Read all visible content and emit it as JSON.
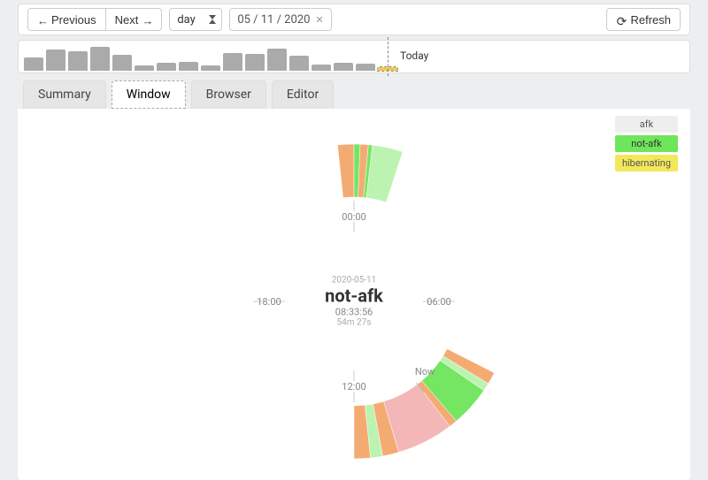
{
  "controls": {
    "previous": "Previous",
    "next": "Next",
    "period_selected": "day",
    "date": "05 / 11 / 2020",
    "refresh": "Refresh"
  },
  "sparkline": {
    "heights_pct": [
      48,
      74,
      70,
      84,
      56,
      20,
      28,
      32,
      20,
      62,
      58,
      78,
      54,
      22,
      28,
      26,
      12
    ],
    "today_index": 16,
    "today_label": "Today"
  },
  "tabs": [
    {
      "key": "summary",
      "label": "Summary"
    },
    {
      "key": "window",
      "label": "Window"
    },
    {
      "key": "browser",
      "label": "Browser"
    },
    {
      "key": "editor",
      "label": "Editor"
    }
  ],
  "active_tab": "window",
  "legend": {
    "afk": "afk",
    "not_afk": "not-afk",
    "hibernating": "hibernating"
  },
  "clock_labels": {
    "t00": "00:00",
    "t06": "06:00",
    "t12": "12:00",
    "t18": "18:00"
  },
  "now_label": "Now",
  "center": {
    "date": "2020-05-11",
    "status": "not-afk",
    "time": "08:33:56",
    "duration": "54m 27s"
  },
  "colors": {
    "afk": "#eeeeee",
    "not_afk": "#6ee55a",
    "not_afk_light": "#b9f2ad",
    "hibernating": "#f2e85a",
    "orange": "#f3a66a",
    "pink": "#f3b3b3"
  },
  "chart_data": {
    "type": "pie",
    "title": "24h activity clock (sunburst)",
    "center_hour_label_top": "00:00",
    "center_hour_label_right": "06:00",
    "center_hour_label_bottom": "12:00",
    "center_hour_label_left": "18:00",
    "now_hour": 9.5,
    "segments": [
      {
        "start_h": 23.6,
        "end_h": 24.0,
        "state": "window-orange"
      },
      {
        "start_h": 0.0,
        "end_h": 0.15,
        "state": "not-afk"
      },
      {
        "start_h": 0.15,
        "end_h": 0.35,
        "state": "window-orange"
      },
      {
        "start_h": 0.35,
        "end_h": 0.45,
        "state": "not-afk"
      },
      {
        "start_h": 0.45,
        "end_h": 1.2,
        "state": "not-afk-light"
      },
      {
        "start_h": 7.8,
        "end_h": 8.1,
        "state": "window-orange"
      },
      {
        "start_h": 8.1,
        "end_h": 8.3,
        "state": "not-afk-light"
      },
      {
        "start_h": 8.3,
        "end_h": 9.3,
        "state": "not-afk"
      },
      {
        "start_h": 9.3,
        "end_h": 9.5,
        "state": "window-orange"
      },
      {
        "start_h": 9.5,
        "end_h": 10.9,
        "state": "window-pink"
      },
      {
        "start_h": 10.9,
        "end_h": 11.3,
        "state": "window-orange"
      },
      {
        "start_h": 11.3,
        "end_h": 11.6,
        "state": "not-afk-light"
      },
      {
        "start_h": 11.6,
        "end_h": 12.0,
        "state": "window-orange"
      },
      {
        "start_h": 12.0,
        "end_h": 12.6,
        "state": "none"
      }
    ]
  }
}
